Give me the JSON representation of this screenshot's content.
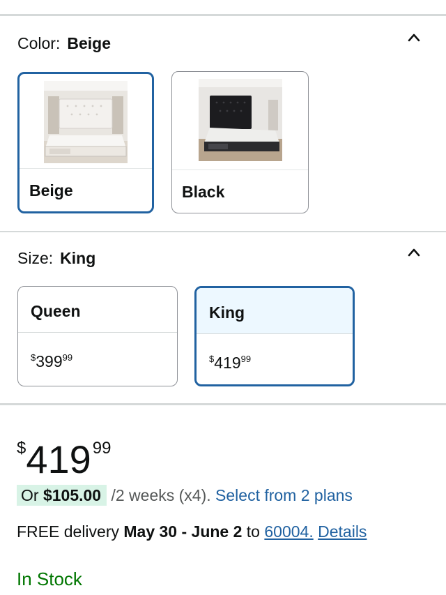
{
  "color_section": {
    "label": "Color:",
    "selected": "Beige",
    "options": [
      {
        "name": "Beige",
        "selected": true,
        "frame_color": "#ece8e2",
        "headboard_color": "#f3f1ee",
        "floor_color": "#ddd6cc"
      },
      {
        "name": "Black",
        "selected": false,
        "frame_color": "#2b2b2e",
        "headboard_color": "#1c1c1f",
        "floor_color": "#b8a58e"
      }
    ]
  },
  "size_section": {
    "label": "Size:",
    "selected": "King",
    "options": [
      {
        "name": "Queen",
        "currency": "$",
        "price_whole": "399",
        "price_cents": "99",
        "selected": false
      },
      {
        "name": "King",
        "currency": "$",
        "price_whole": "419",
        "price_cents": "99",
        "selected": true
      }
    ]
  },
  "price": {
    "currency": "$",
    "whole": "419",
    "cents": "99"
  },
  "installment": {
    "prefix": "Or",
    "amount": "$105.00",
    "term": "/2 weeks (x4).",
    "link": "Select from 2 plans"
  },
  "delivery": {
    "prefix": "FREE delivery",
    "dates": "May 30 - June 2",
    "to": "to",
    "zip": "60004.",
    "details": "Details"
  },
  "stock_status": "In Stock",
  "icons": {
    "collapse": "chevron-up-icon"
  },
  "colors": {
    "accent": "#2162a1",
    "stock": "#007600",
    "installment_bg": "#d8f3e6"
  }
}
